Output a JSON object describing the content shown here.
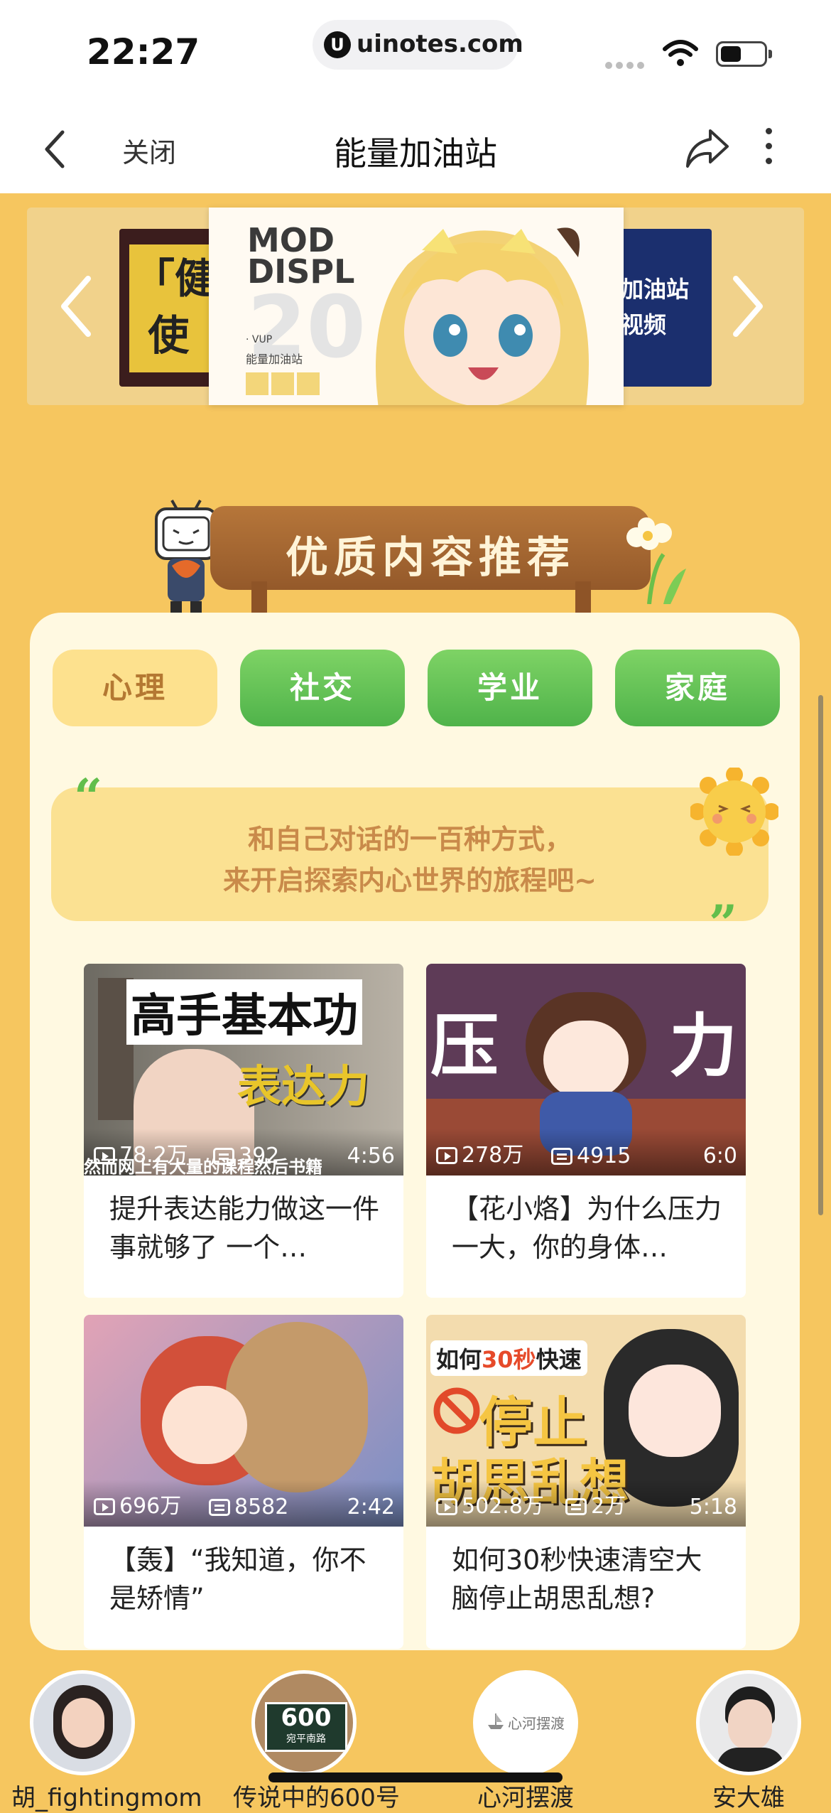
{
  "status_bar": {
    "time": "22:27",
    "url": "uinotes.com"
  },
  "nav": {
    "close_label": "关闭",
    "title": "能量加油站"
  },
  "banner": {
    "left_text": "「健\n 使",
    "main_heading": "MOD\nDISPL",
    "main_number": "20",
    "main_tag": "· VUP",
    "main_sub": "能量加油站",
    "right_text": "加油站\n视频"
  },
  "section": {
    "title": "优质内容推荐"
  },
  "tabs": [
    {
      "label": "心理",
      "active": true
    },
    {
      "label": "社交",
      "active": false
    },
    {
      "label": "学业",
      "active": false
    },
    {
      "label": "家庭",
      "active": false
    }
  ],
  "quote": {
    "line1": "和自己对话的一百种方式，",
    "line2": "来开启探索内心世界的旅程吧~"
  },
  "videos": [
    {
      "thumb_text1": "高手基本功",
      "thumb_text2": "表达力",
      "thumb_caption": "然而网上有大量的课程然后书籍",
      "views": "78.2万",
      "danmaku": "392",
      "duration": "4:56",
      "title": "提升表达能力做这一件事就够了 一个…"
    },
    {
      "thumb_text1": "压",
      "thumb_text2": "力",
      "views": "278万",
      "danmaku": "4915",
      "duration": "6:0",
      "title": "【花小烙】为什么压力一大，你的身体…"
    },
    {
      "views": "696万",
      "danmaku": "8582",
      "duration": "2:42",
      "title": "【轰】“我知道，你不是矫情”"
    },
    {
      "thumb_badge_pre": "如何",
      "thumb_badge_hl": "30秒",
      "thumb_badge_post": "快速",
      "thumb_text1": "停止",
      "thumb_text2": "胡思乱想",
      "views": "502.8万",
      "danmaku": "2万",
      "duration": "5:18",
      "title": "如何30秒快速清空大脑停止胡思乱想?"
    }
  ],
  "avatars": [
    {
      "name": "胡_fightingmom"
    },
    {
      "name": "传说中的600号",
      "badge_num": "600",
      "badge_text": "宛平南路"
    },
    {
      "name": "心河摆渡",
      "logo_text": "心河摆渡"
    },
    {
      "name": "安大雄"
    }
  ],
  "colors": {
    "page_bg": "#f6c65f",
    "card_bg": "#fff9e1",
    "tab_green": "#5bbd4d",
    "tab_active": "#fde18e",
    "quote_text": "#c98a4a"
  }
}
